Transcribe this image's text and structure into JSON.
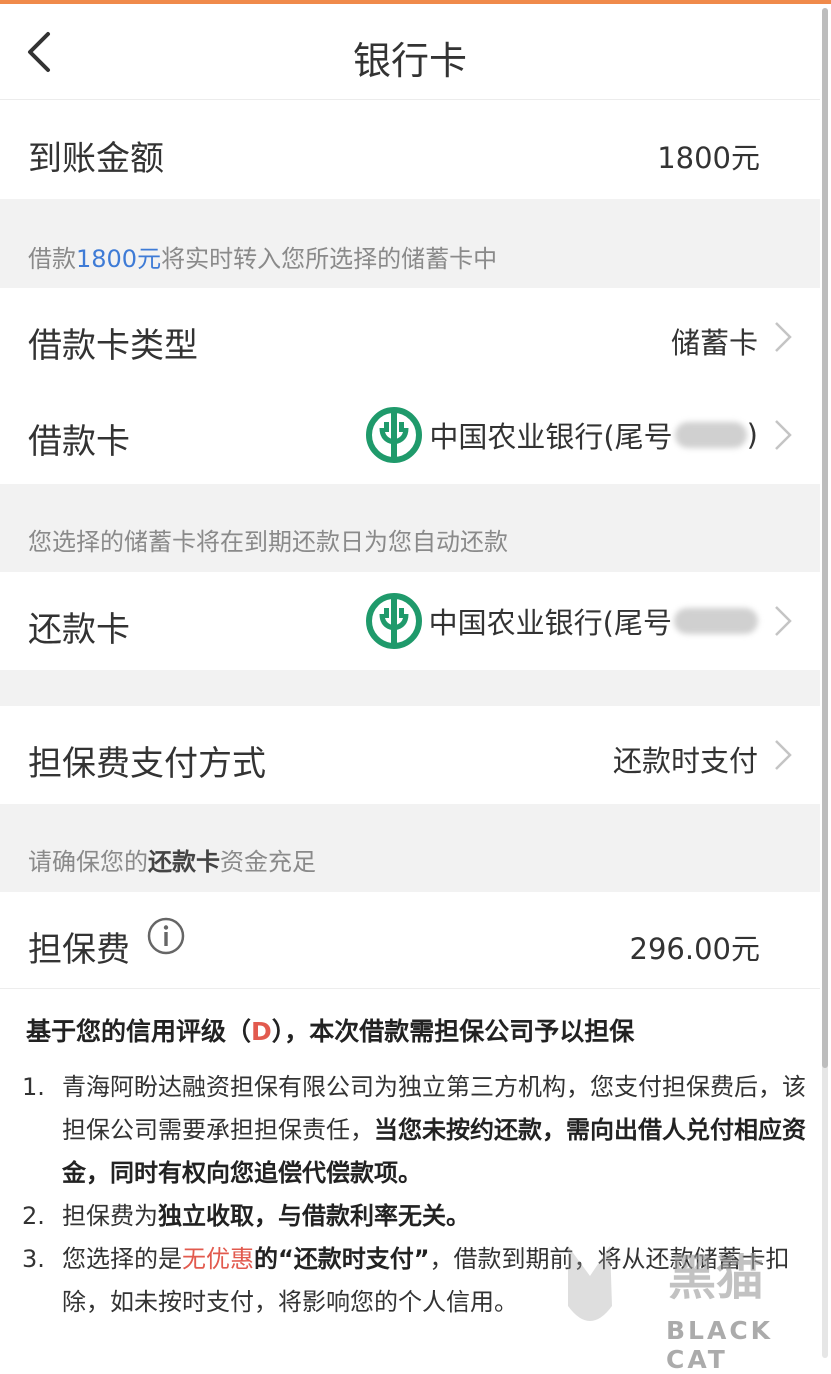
{
  "header": {
    "title": "银行卡"
  },
  "amount_row": {
    "label": "到账金额",
    "value": "1800元"
  },
  "note1": {
    "prefix": "借款",
    "amount": "1800元",
    "suffix": "将实时转入您所选择的储蓄卡中"
  },
  "card_type_row": {
    "label": "借款卡类型",
    "value": "储蓄卡"
  },
  "loan_card_row": {
    "label": "借款卡",
    "bank": "中国农业银行(尾号",
    "suffix": ")"
  },
  "note2": {
    "text": "您选择的储蓄卡将在到期还款日为您自动还款"
  },
  "repay_card_row": {
    "label": "还款卡",
    "bank": "中国农业银行(尾号"
  },
  "guarantee_method_row": {
    "label": "担保费支付方式",
    "value": "还款时支付"
  },
  "note3": {
    "prefix": "请确保您的",
    "bold": "还款卡",
    "suffix": "资金充足"
  },
  "guarantee_fee_row": {
    "label": "担保费",
    "value": "296.00元"
  },
  "description": {
    "title_prefix": "基于您的信用评级（",
    "grade": "D",
    "title_suffix": "），本次借款需担保公司予以担保",
    "items": [
      {
        "num": "1.",
        "text1": "青海阿盼达融资担保有限公司为独立第三方机构，您支付担保费后，该担保公司需要承担担保责任，",
        "bold1": "当您未按约还款，需向出借人兑付相应资金，同时有权向您追偿代偿款项。"
      },
      {
        "num": "2.",
        "text1": "担保费为",
        "bold1": "独立收取，与借款利率无关。"
      },
      {
        "num": "3.",
        "text1": "您选择的是",
        "red": "无优惠",
        "bold1": "的“还款时支付”",
        "text2": "，借款到期前，将从还款储蓄卡扣除，如未按时支付，将影响您的个人信用。"
      }
    ]
  },
  "watermark": {
    "cn": "黑猫",
    "en": "BLACK CAT"
  },
  "colors": {
    "accent_blue": "#3e7bd6",
    "grade_red": "#e25a4e",
    "bank_green": "#1f9a6b",
    "top_bar": "#f08a4b"
  },
  "icons": {
    "back": "chevron-left-icon",
    "arrow": "chevron-right-icon",
    "info": "info-circle-icon",
    "bank": "abc-bank-logo-icon"
  }
}
